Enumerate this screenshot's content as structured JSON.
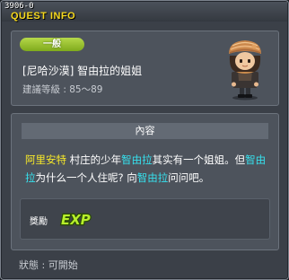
{
  "window": {
    "quest_id": "3906-0",
    "title": "QUEST INFO"
  },
  "quest": {
    "category": "一般",
    "name": "[尼哈沙漠] 智由拉的姐姐",
    "level_text": "建議等級 : 85～89"
  },
  "content": {
    "header": "內容",
    "description": {
      "seg1": "阿里安特",
      "seg2": " 村庄的少年",
      "seg3": "智由拉",
      "seg4": "其实有一个姐姐。但",
      "seg5": "智由拉",
      "seg6": "为什么一个人住呢? 向",
      "seg7": "智由拉",
      "seg8": "问问吧。"
    }
  },
  "reward": {
    "label": "獎勵",
    "exp_text": "EXP"
  },
  "status": {
    "text": "狀態 : 可開始"
  },
  "colors": {
    "title": "#f7d91e",
    "badge": "#8fbd28",
    "npc_name": "#f7e829",
    "highlight": "#36e1ee",
    "exp": "#b7ef2b"
  },
  "icons": {
    "npc": "npc-turban-boy",
    "reward": "exp-icon"
  }
}
